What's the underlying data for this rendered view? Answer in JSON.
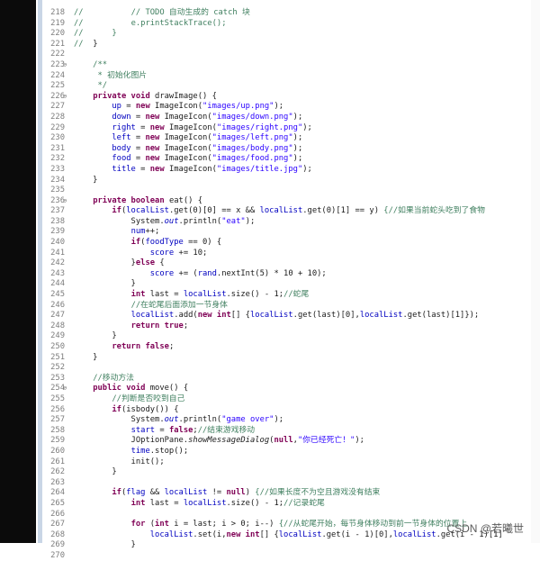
{
  "watermark": "CSDN @若曦世",
  "lines": [
    {
      "n": "218",
      "f": "",
      "tokens": [
        {
          "t": "//          ",
          "c": "cm"
        },
        {
          "t": "// TODO 自动生成的 catch 块",
          "c": "cm"
        }
      ]
    },
    {
      "n": "219",
      "f": "",
      "tokens": [
        {
          "t": "//          ",
          "c": "cm"
        },
        {
          "t": "e.printStackTrace();",
          "c": "cm"
        }
      ]
    },
    {
      "n": "220",
      "f": "",
      "tokens": [
        {
          "t": "//      ",
          "c": "cm"
        },
        {
          "t": "}",
          "c": "cm"
        }
      ]
    },
    {
      "n": "221",
      "f": "",
      "tokens": [
        {
          "t": "//  ",
          "c": "cm"
        },
        {
          "t": "}",
          "c": ""
        }
      ]
    },
    {
      "n": "222",
      "f": "",
      "tokens": []
    },
    {
      "n": "223",
      "f": "⊖",
      "tokens": [
        {
          "t": "    /**",
          "c": "cm"
        }
      ]
    },
    {
      "n": "224",
      "f": "",
      "tokens": [
        {
          "t": "     * 初始化图片",
          "c": "cm"
        }
      ]
    },
    {
      "n": "225",
      "f": "",
      "tokens": [
        {
          "t": "     */",
          "c": "cm"
        }
      ]
    },
    {
      "n": "226",
      "f": "⊖",
      "tokens": [
        {
          "t": "    ",
          "c": ""
        },
        {
          "t": "private void ",
          "c": "kw"
        },
        {
          "t": "drawImage() {",
          "c": ""
        }
      ]
    },
    {
      "n": "227",
      "f": "",
      "tokens": [
        {
          "t": "        ",
          "c": ""
        },
        {
          "t": "up",
          "c": "fld"
        },
        {
          "t": " = ",
          "c": ""
        },
        {
          "t": "new ",
          "c": "kw"
        },
        {
          "t": "ImageIcon(",
          "c": ""
        },
        {
          "t": "\"images/up.png\"",
          "c": "str"
        },
        {
          "t": ");",
          "c": ""
        }
      ]
    },
    {
      "n": "228",
      "f": "",
      "tokens": [
        {
          "t": "        ",
          "c": ""
        },
        {
          "t": "down",
          "c": "fld"
        },
        {
          "t": " = ",
          "c": ""
        },
        {
          "t": "new ",
          "c": "kw"
        },
        {
          "t": "ImageIcon(",
          "c": ""
        },
        {
          "t": "\"images/down.png\"",
          "c": "str"
        },
        {
          "t": ");",
          "c": ""
        }
      ]
    },
    {
      "n": "229",
      "f": "",
      "tokens": [
        {
          "t": "        ",
          "c": ""
        },
        {
          "t": "right",
          "c": "fld"
        },
        {
          "t": " = ",
          "c": ""
        },
        {
          "t": "new ",
          "c": "kw"
        },
        {
          "t": "ImageIcon(",
          "c": ""
        },
        {
          "t": "\"images/right.png\"",
          "c": "str"
        },
        {
          "t": ");",
          "c": ""
        }
      ]
    },
    {
      "n": "230",
      "f": "",
      "tokens": [
        {
          "t": "        ",
          "c": ""
        },
        {
          "t": "left",
          "c": "fld"
        },
        {
          "t": " = ",
          "c": ""
        },
        {
          "t": "new ",
          "c": "kw"
        },
        {
          "t": "ImageIcon(",
          "c": ""
        },
        {
          "t": "\"images/left.png\"",
          "c": "str"
        },
        {
          "t": ");",
          "c": ""
        }
      ]
    },
    {
      "n": "231",
      "f": "",
      "tokens": [
        {
          "t": "        ",
          "c": ""
        },
        {
          "t": "body",
          "c": "fld"
        },
        {
          "t": " = ",
          "c": ""
        },
        {
          "t": "new ",
          "c": "kw"
        },
        {
          "t": "ImageIcon(",
          "c": ""
        },
        {
          "t": "\"images/body.png\"",
          "c": "str"
        },
        {
          "t": ");",
          "c": ""
        }
      ]
    },
    {
      "n": "232",
      "f": "",
      "tokens": [
        {
          "t": "        ",
          "c": ""
        },
        {
          "t": "food",
          "c": "fld"
        },
        {
          "t": " = ",
          "c": ""
        },
        {
          "t": "new ",
          "c": "kw"
        },
        {
          "t": "ImageIcon(",
          "c": ""
        },
        {
          "t": "\"images/food.png\"",
          "c": "str"
        },
        {
          "t": ");",
          "c": ""
        }
      ]
    },
    {
      "n": "233",
      "f": "",
      "tokens": [
        {
          "t": "        ",
          "c": ""
        },
        {
          "t": "title",
          "c": "fld"
        },
        {
          "t": " = ",
          "c": ""
        },
        {
          "t": "new ",
          "c": "kw"
        },
        {
          "t": "ImageIcon(",
          "c": ""
        },
        {
          "t": "\"images/title.jpg\"",
          "c": "str"
        },
        {
          "t": ");",
          "c": ""
        }
      ]
    },
    {
      "n": "234",
      "f": "",
      "tokens": [
        {
          "t": "    }",
          "c": ""
        }
      ]
    },
    {
      "n": "235",
      "f": "",
      "tokens": []
    },
    {
      "n": "236",
      "f": "⊖",
      "tokens": [
        {
          "t": "    ",
          "c": ""
        },
        {
          "t": "private boolean ",
          "c": "kw"
        },
        {
          "t": "eat() {",
          "c": ""
        }
      ]
    },
    {
      "n": "237",
      "f": "",
      "tokens": [
        {
          "t": "        ",
          "c": ""
        },
        {
          "t": "if",
          "c": "kw"
        },
        {
          "t": "(",
          "c": ""
        },
        {
          "t": "localList",
          "c": "fld"
        },
        {
          "t": ".get(0)[0] == x && ",
          "c": ""
        },
        {
          "t": "localList",
          "c": "fld"
        },
        {
          "t": ".get(0)[1] == y) ",
          "c": ""
        },
        {
          "t": "{//如果当前蛇头吃到了食物",
          "c": "cm"
        }
      ]
    },
    {
      "n": "238",
      "f": "",
      "tokens": [
        {
          "t": "            System.",
          "c": ""
        },
        {
          "t": "out",
          "c": "fld it"
        },
        {
          "t": ".println(",
          "c": ""
        },
        {
          "t": "\"eat\"",
          "c": "str"
        },
        {
          "t": ");",
          "c": ""
        }
      ]
    },
    {
      "n": "239",
      "f": "",
      "tokens": [
        {
          "t": "            ",
          "c": ""
        },
        {
          "t": "num",
          "c": "fld"
        },
        {
          "t": "++;",
          "c": ""
        }
      ]
    },
    {
      "n": "240",
      "f": "",
      "tokens": [
        {
          "t": "            ",
          "c": ""
        },
        {
          "t": "if",
          "c": "kw"
        },
        {
          "t": "(",
          "c": ""
        },
        {
          "t": "foodType",
          "c": "fld"
        },
        {
          "t": " == 0) {",
          "c": ""
        }
      ]
    },
    {
      "n": "241",
      "f": "",
      "tokens": [
        {
          "t": "                ",
          "c": ""
        },
        {
          "t": "score",
          "c": "fld"
        },
        {
          "t": " += 10;",
          "c": ""
        }
      ]
    },
    {
      "n": "242",
      "f": "",
      "tokens": [
        {
          "t": "            }",
          "c": ""
        },
        {
          "t": "else",
          "c": "kw"
        },
        {
          "t": " {",
          "c": ""
        }
      ]
    },
    {
      "n": "243",
      "f": "",
      "tokens": [
        {
          "t": "                ",
          "c": ""
        },
        {
          "t": "score",
          "c": "fld"
        },
        {
          "t": " += (",
          "c": ""
        },
        {
          "t": "rand",
          "c": "fld"
        },
        {
          "t": ".nextInt(5) * 10 + 10);",
          "c": ""
        }
      ]
    },
    {
      "n": "244",
      "f": "",
      "tokens": [
        {
          "t": "            }",
          "c": ""
        }
      ]
    },
    {
      "n": "245",
      "f": "",
      "tokens": [
        {
          "t": "            ",
          "c": ""
        },
        {
          "t": "int ",
          "c": "kw"
        },
        {
          "t": "last = ",
          "c": ""
        },
        {
          "t": "localList",
          "c": "fld"
        },
        {
          "t": ".size() - 1;",
          "c": ""
        },
        {
          "t": "//蛇尾",
          "c": "cm"
        }
      ]
    },
    {
      "n": "246",
      "f": "",
      "tokens": [
        {
          "t": "            ",
          "c": ""
        },
        {
          "t": "//在蛇尾后面添加一节身体",
          "c": "cm"
        }
      ]
    },
    {
      "n": "247",
      "f": "",
      "tokens": [
        {
          "t": "            ",
          "c": ""
        },
        {
          "t": "localList",
          "c": "fld"
        },
        {
          "t": ".add(",
          "c": ""
        },
        {
          "t": "new int",
          "c": "kw"
        },
        {
          "t": "[] {",
          "c": ""
        },
        {
          "t": "localList",
          "c": "fld"
        },
        {
          "t": ".get(last)[0],",
          "c": ""
        },
        {
          "t": "localList",
          "c": "fld"
        },
        {
          "t": ".get(last)[1]});",
          "c": ""
        }
      ]
    },
    {
      "n": "248",
      "f": "",
      "tokens": [
        {
          "t": "            ",
          "c": ""
        },
        {
          "t": "return true",
          "c": "kw"
        },
        {
          "t": ";",
          "c": ""
        }
      ]
    },
    {
      "n": "249",
      "f": "",
      "tokens": [
        {
          "t": "        }",
          "c": ""
        }
      ]
    },
    {
      "n": "250",
      "f": "",
      "tokens": [
        {
          "t": "        ",
          "c": ""
        },
        {
          "t": "return false",
          "c": "kw"
        },
        {
          "t": ";",
          "c": ""
        }
      ]
    },
    {
      "n": "251",
      "f": "",
      "tokens": [
        {
          "t": "    }",
          "c": ""
        }
      ]
    },
    {
      "n": "252",
      "f": "",
      "tokens": []
    },
    {
      "n": "253",
      "f": "",
      "tokens": [
        {
          "t": "    ",
          "c": ""
        },
        {
          "t": "//移动方法",
          "c": "cm"
        }
      ]
    },
    {
      "n": "254",
      "f": "⊖",
      "tokens": [
        {
          "t": "    ",
          "c": ""
        },
        {
          "t": "public void ",
          "c": "kw"
        },
        {
          "t": "move() {",
          "c": ""
        }
      ]
    },
    {
      "n": "255",
      "f": "",
      "tokens": [
        {
          "t": "        ",
          "c": ""
        },
        {
          "t": "//判断是否咬到自己",
          "c": "cm"
        }
      ]
    },
    {
      "n": "256",
      "f": "",
      "tokens": [
        {
          "t": "        ",
          "c": ""
        },
        {
          "t": "if",
          "c": "kw"
        },
        {
          "t": "(isbody()) {",
          "c": ""
        }
      ]
    },
    {
      "n": "257",
      "f": "",
      "tokens": [
        {
          "t": "            System.",
          "c": ""
        },
        {
          "t": "out",
          "c": "fld it"
        },
        {
          "t": ".println(",
          "c": ""
        },
        {
          "t": "\"game over\"",
          "c": "str"
        },
        {
          "t": ");",
          "c": ""
        }
      ]
    },
    {
      "n": "258",
      "f": "",
      "tokens": [
        {
          "t": "            ",
          "c": ""
        },
        {
          "t": "start",
          "c": "fld"
        },
        {
          "t": " = ",
          "c": ""
        },
        {
          "t": "false",
          "c": "kw"
        },
        {
          "t": ";",
          "c": ""
        },
        {
          "t": "//结束游戏移动",
          "c": "cm"
        }
      ]
    },
    {
      "n": "259",
      "f": "",
      "tokens": [
        {
          "t": "            JOptionPane.",
          "c": ""
        },
        {
          "t": "showMessageDialog",
          "c": "it"
        },
        {
          "t": "(",
          "c": ""
        },
        {
          "t": "null",
          "c": "kw"
        },
        {
          "t": ",",
          "c": ""
        },
        {
          "t": "\"你已经死亡！\"",
          "c": "str"
        },
        {
          "t": ");",
          "c": ""
        }
      ]
    },
    {
      "n": "260",
      "f": "",
      "tokens": [
        {
          "t": "            ",
          "c": ""
        },
        {
          "t": "time",
          "c": "fld"
        },
        {
          "t": ".stop();",
          "c": ""
        }
      ]
    },
    {
      "n": "261",
      "f": "",
      "tokens": [
        {
          "t": "            init();",
          "c": ""
        }
      ]
    },
    {
      "n": "262",
      "f": "",
      "tokens": [
        {
          "t": "        }",
          "c": ""
        }
      ]
    },
    {
      "n": "263",
      "f": "",
      "tokens": []
    },
    {
      "n": "264",
      "f": "",
      "tokens": [
        {
          "t": "        ",
          "c": ""
        },
        {
          "t": "if",
          "c": "kw"
        },
        {
          "t": "(",
          "c": ""
        },
        {
          "t": "flag",
          "c": "fld"
        },
        {
          "t": " && ",
          "c": ""
        },
        {
          "t": "localList",
          "c": "fld"
        },
        {
          "t": " != ",
          "c": ""
        },
        {
          "t": "null",
          "c": "kw"
        },
        {
          "t": ") ",
          "c": ""
        },
        {
          "t": "{//如果长度不为空且游戏没有结束",
          "c": "cm"
        }
      ]
    },
    {
      "n": "265",
      "f": "",
      "tokens": [
        {
          "t": "            ",
          "c": ""
        },
        {
          "t": "int ",
          "c": "kw"
        },
        {
          "t": "last = ",
          "c": ""
        },
        {
          "t": "localList",
          "c": "fld"
        },
        {
          "t": ".size() - 1;",
          "c": ""
        },
        {
          "t": "//记录蛇尾",
          "c": "cm"
        }
      ]
    },
    {
      "n": "266",
      "f": "",
      "tokens": []
    },
    {
      "n": "267",
      "f": "",
      "tokens": [
        {
          "t": "            ",
          "c": ""
        },
        {
          "t": "for ",
          "c": "kw"
        },
        {
          "t": "(",
          "c": ""
        },
        {
          "t": "int ",
          "c": "kw"
        },
        {
          "t": "i = last; i > 0; i--) ",
          "c": ""
        },
        {
          "t": "{//从蛇尾开始，每节身体移动到前一节身体的位置上",
          "c": "cm"
        }
      ]
    },
    {
      "n": "268",
      "f": "",
      "tokens": [
        {
          "t": "                ",
          "c": ""
        },
        {
          "t": "localList",
          "c": "fld"
        },
        {
          "t": ".set(i,",
          "c": ""
        },
        {
          "t": "new int",
          "c": "kw"
        },
        {
          "t": "[] {",
          "c": ""
        },
        {
          "t": "localList",
          "c": "fld"
        },
        {
          "t": ".get(i - 1)[0],",
          "c": ""
        },
        {
          "t": "localList",
          "c": "fld"
        },
        {
          "t": ".get(i - 1)[1]",
          "c": ""
        }
      ]
    },
    {
      "n": "269",
      "f": "",
      "tokens": [
        {
          "t": "            }",
          "c": ""
        }
      ]
    },
    {
      "n": "270",
      "f": "",
      "tokens": []
    }
  ]
}
